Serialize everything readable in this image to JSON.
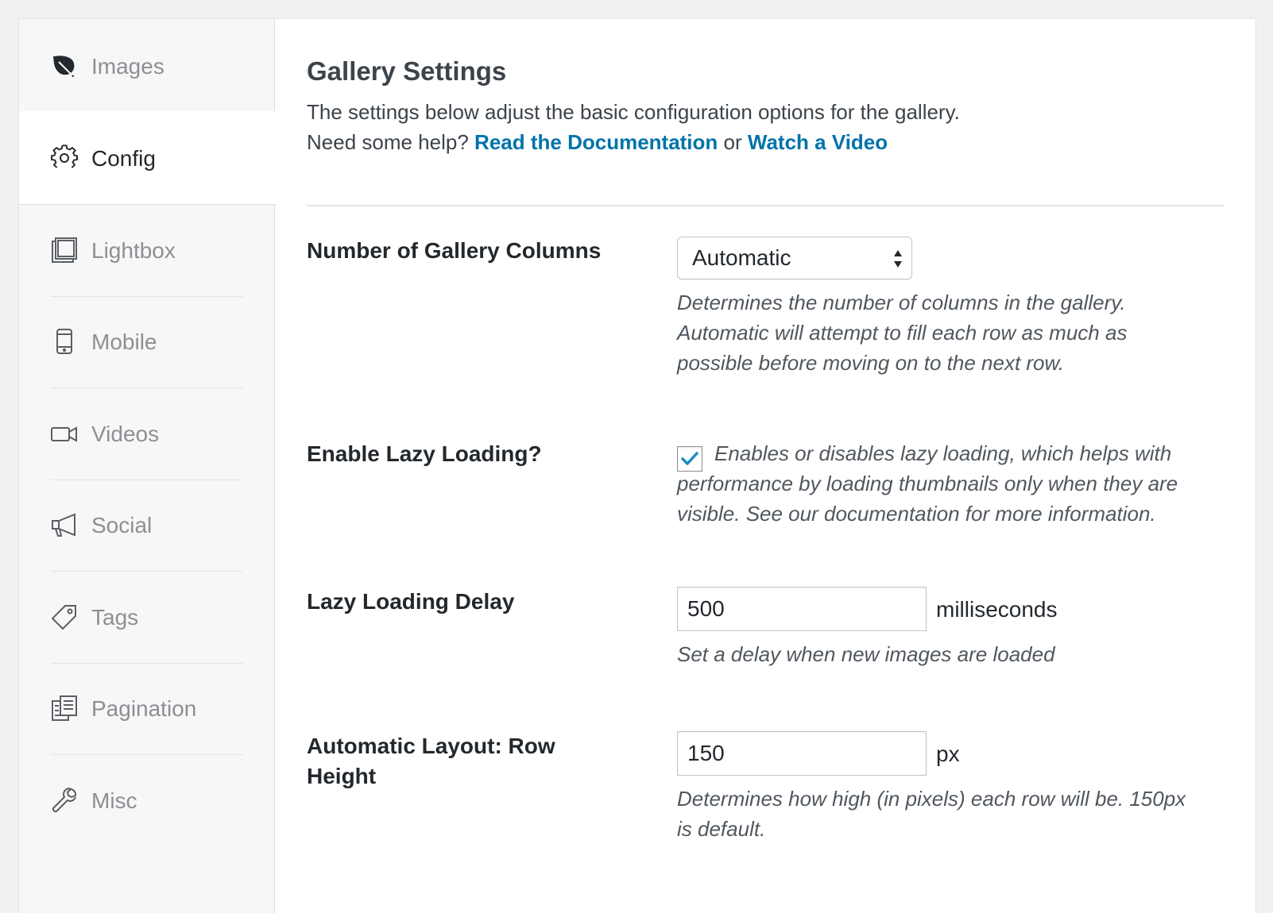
{
  "sidebar": {
    "items": [
      {
        "label": "Images",
        "icon": "leaf-icon"
      },
      {
        "label": "Config",
        "icon": "gear-icon"
      },
      {
        "label": "Lightbox",
        "icon": "lightbox-icon"
      },
      {
        "label": "Mobile",
        "icon": "mobile-icon"
      },
      {
        "label": "Videos",
        "icon": "video-camera-icon"
      },
      {
        "label": "Social",
        "icon": "megaphone-icon"
      },
      {
        "label": "Tags",
        "icon": "tag-icon"
      },
      {
        "label": "Pagination",
        "icon": "pagination-icon"
      },
      {
        "label": "Misc",
        "icon": "wrench-icon"
      }
    ],
    "active": "Config"
  },
  "main": {
    "title": "Gallery Settings",
    "description": "The settings below adjust the basic configuration options for the gallery.",
    "help_prefix": "Need some help?",
    "doc_link": "Read the Documentation",
    "or_text": "or",
    "video_link": "Watch a Video"
  },
  "settings": {
    "columns": {
      "label": "Number of Gallery Columns",
      "value": "Automatic",
      "help_lines": [
        "Determines the number of columns in the gallery.",
        "Automatic will attempt to fill each row as much as",
        "possible before moving on to the next row."
      ]
    },
    "lazy": {
      "label": "Enable Lazy Loading?",
      "checked": true,
      "help_lines": [
        "Enables or disables lazy loading, which helps with",
        "performance by loading thumbnails only when they are",
        "visible. See our documentation for more information."
      ]
    },
    "delay": {
      "label": "Lazy Loading Delay",
      "value": "500",
      "unit": "milliseconds",
      "help": "Set a delay when new images are loaded"
    },
    "row_height": {
      "label_lines": [
        "Automatic Layout: Row",
        "Height"
      ],
      "value": "150",
      "unit": "px",
      "help_lines": [
        "Determines how high (in pixels) each row will be. 150px",
        "is default."
      ]
    }
  },
  "colors": {
    "link": "#0073aa",
    "checkmark": "#1e8cbe"
  }
}
